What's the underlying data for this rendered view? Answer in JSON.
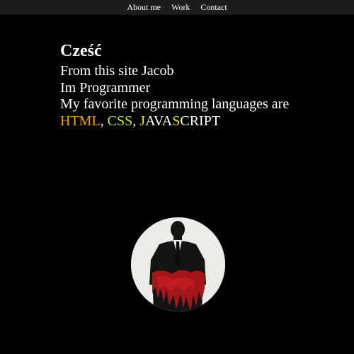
{
  "nav": {
    "items": [
      "About me",
      "Work",
      "Contact"
    ]
  },
  "intro": {
    "greeting": "Cześć",
    "line1": "From this site Jacob",
    "line2": "Im Programmer",
    "line3": "My favorite programming languages are",
    "languages": {
      "html": "HTML",
      "sep1": ", ",
      "css": "CSS",
      "sep2": ", ",
      "js_part1": "J",
      "js_part2": "AVA",
      "js_part3": "S",
      "js_part4": "CRIPT"
    }
  },
  "colors": {
    "background": "#000000",
    "nav_background": "#1c1c1c",
    "html": "#f0a30a",
    "css": "#c8e632",
    "js_highlight": "#f5e000"
  },
  "avatar": {
    "icon": "man-in-suit-silhouette-icon"
  }
}
